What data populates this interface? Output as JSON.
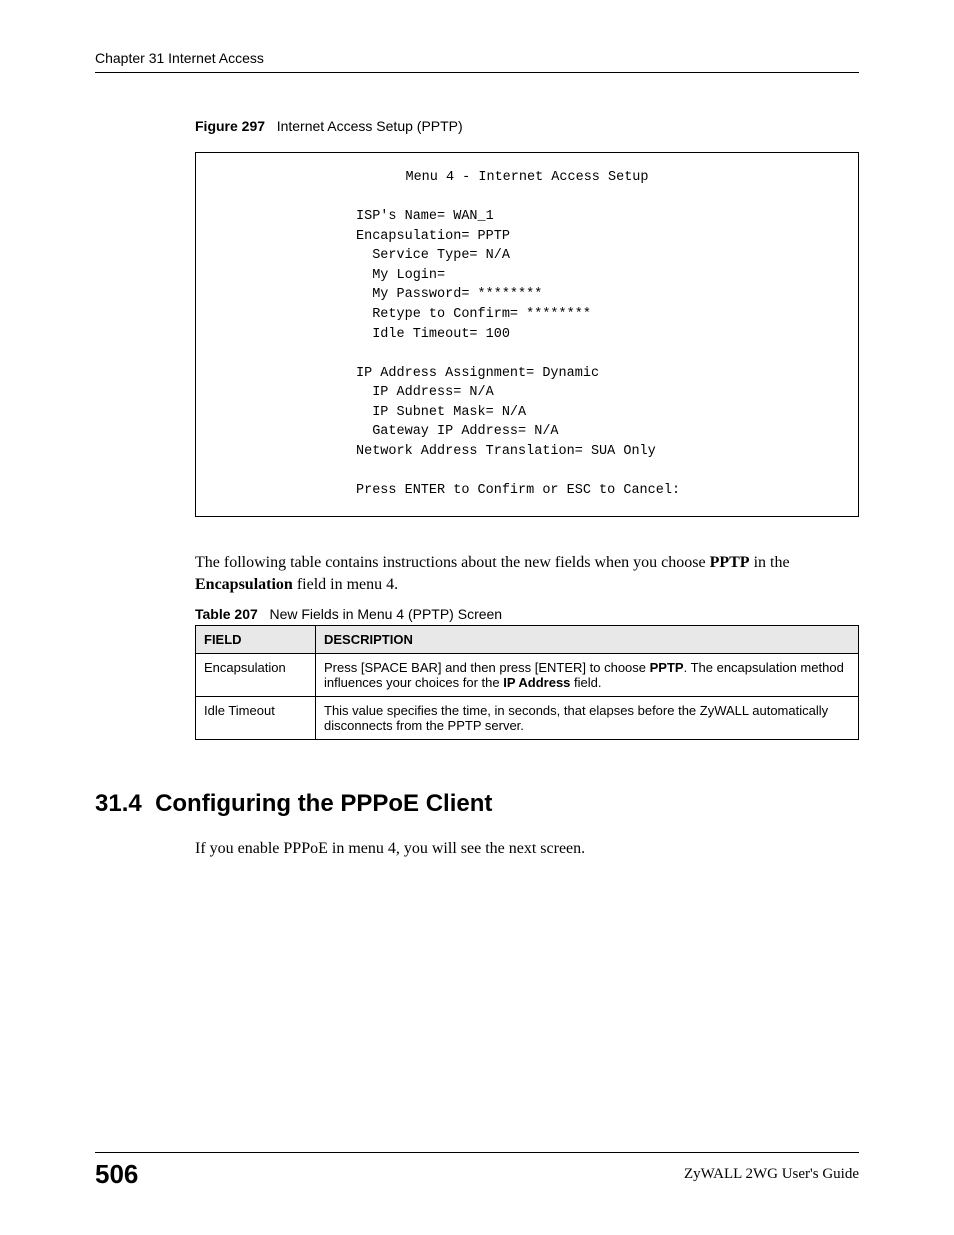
{
  "header": "Chapter 31 Internet Access",
  "figure": {
    "label": "Figure 297",
    "caption": "Internet Access Setup (PPTP)"
  },
  "codebox": {
    "title": "Menu 4 - Internet Access Setup",
    "lines": [
      "",
      "ISP's Name= WAN_1",
      "Encapsulation= PPTP",
      "  Service Type= N/A",
      "  My Login=",
      "  My Password= ********",
      "  Retype to Confirm= ********",
      "  Idle Timeout= 100",
      "",
      "IP Address Assignment= Dynamic",
      "  IP Address= N/A",
      "  IP Subnet Mask= N/A",
      "  Gateway IP Address= N/A",
      "Network Address Translation= SUA Only",
      "",
      "Press ENTER to Confirm or ESC to Cancel:"
    ]
  },
  "para1_pre": "The following table contains instructions about the new fields when you choose ",
  "para1_bold1": "PPTP",
  "para1_mid": " in the ",
  "para1_bold2": "Encapsulation",
  "para1_post": " field in menu 4.",
  "table": {
    "label": "Table 207",
    "caption": "New Fields in Menu 4 (PPTP) Screen",
    "headers": [
      "FIELD",
      "DESCRIPTION"
    ],
    "rows": [
      {
        "field": "Encapsulation",
        "desc_pre": "Press [SPACE BAR] and then press [ENTER] to choose ",
        "desc_b1": "PPTP",
        "desc_mid": ". The encapsulation method influences your choices for the ",
        "desc_b2": "IP Address",
        "desc_post": " field."
      },
      {
        "field": "Idle Timeout",
        "desc": "This value specifies the time, in seconds, that elapses before the ZyWALL automatically disconnects from the PPTP server."
      }
    ]
  },
  "section": {
    "number": "31.4",
    "title": "Configuring the PPPoE Client"
  },
  "para2": "If you enable PPPoE in menu 4, you will see the next screen.",
  "footer": {
    "page": "506",
    "guide": "ZyWALL 2WG User's Guide"
  }
}
